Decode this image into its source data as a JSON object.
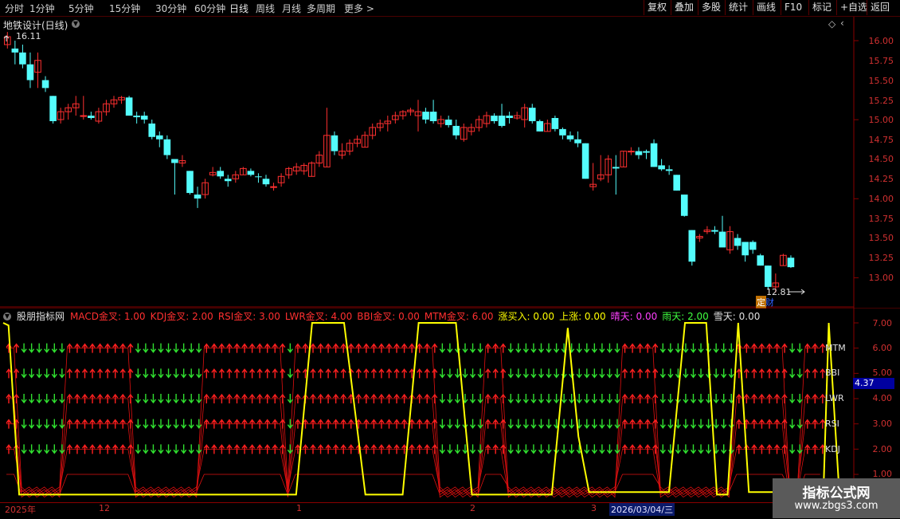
{
  "toolbar": {
    "periods": [
      "分时",
      "1分钟",
      "5分钟",
      "15分钟",
      "30分钟",
      "60分钟",
      "日线",
      "周线",
      "月线",
      "多周期",
      "更多 >"
    ],
    "active_period": "日线",
    "buttons": [
      "复权",
      "叠加",
      "多股",
      "统计",
      "画线",
      "F10",
      "标记",
      "+自选",
      "返回"
    ]
  },
  "chart": {
    "title": "地铁设计(日线)",
    "high_label": "16.11",
    "low_label": "12.81",
    "ding_label": "定",
    "cai_label": "财",
    "price_ticks": [
      "16.00",
      "15.75",
      "15.50",
      "15.25",
      "15.00",
      "14.75",
      "14.50",
      "14.25",
      "14.00",
      "13.75",
      "13.50",
      "13.25",
      "13.00"
    ]
  },
  "indicator": {
    "name": "股朋指标网",
    "values": [
      {
        "label": "MACD金叉: 1.00",
        "color": "#ff3030"
      },
      {
        "label": "KDJ金叉: 2.00",
        "color": "#ff3030"
      },
      {
        "label": "RSI金叉: 3.00",
        "color": "#ff3030"
      },
      {
        "label": "LWR金叉: 4.00",
        "color": "#ff3030"
      },
      {
        "label": "BBI金叉: 0.00",
        "color": "#ff3030"
      },
      {
        "label": "MTM金叉: 6.00",
        "color": "#ff3030"
      },
      {
        "label": "涨买入: 0.00",
        "color": "#ffff00"
      },
      {
        "label": "上涨: 0.00",
        "color": "#ffff00"
      },
      {
        "label": "晴天: 0.00",
        "color": "#ff40ff"
      },
      {
        "label": "雨天: 2.00",
        "color": "#40ff40"
      },
      {
        "label": "雪天: 0.00",
        "color": "#e0e0e0"
      }
    ],
    "ticks": [
      "7.00",
      "6.00",
      "5.00",
      "4.00",
      "3.00",
      "2.00",
      "1.00"
    ],
    "current_value": "4.37",
    "line_labels": [
      "MTM",
      "BBI",
      "LWR",
      "RSI",
      "KDJ"
    ]
  },
  "dates": {
    "labels": [
      "2025年",
      "12",
      "1",
      "2",
      "3"
    ],
    "highlight": "2026/03/04/三"
  },
  "watermark": {
    "title": "指标公式网",
    "url": "www.zbgs3.com"
  },
  "candles": [
    [
      15.95,
      16.11,
      15.9,
      16.05
    ],
    [
      15.9,
      16.0,
      15.7,
      15.85
    ],
    [
      15.85,
      15.95,
      15.65,
      15.7
    ],
    [
      15.7,
      15.85,
      15.4,
      15.5
    ],
    [
      15.6,
      15.85,
      15.4,
      15.75
    ],
    [
      15.5,
      15.55,
      15.35,
      15.4
    ],
    [
      15.3,
      15.3,
      14.95,
      14.98
    ],
    [
      15.0,
      15.15,
      14.95,
      15.1
    ],
    [
      15.1,
      15.2,
      15.0,
      15.15
    ],
    [
      15.15,
      15.3,
      15.05,
      15.2
    ],
    [
      15.05,
      15.3,
      15.0,
      15.05
    ],
    [
      15.05,
      15.1,
      15.0,
      15.02
    ],
    [
      14.98,
      15.15,
      14.95,
      15.1
    ],
    [
      15.1,
      15.25,
      15.05,
      15.2
    ],
    [
      15.2,
      15.3,
      15.15,
      15.25
    ],
    [
      15.25,
      15.3,
      15.2,
      15.28
    ],
    [
      15.28,
      15.3,
      15.05,
      15.05
    ],
    [
      15.05,
      15.1,
      14.95,
      15.03
    ],
    [
      15.05,
      15.1,
      14.95,
      15.0
    ],
    [
      14.95,
      15.0,
      14.75,
      14.78
    ],
    [
      14.8,
      14.85,
      14.65,
      14.75
    ],
    [
      14.75,
      14.8,
      14.5,
      14.55
    ],
    [
      14.5,
      14.5,
      14.05,
      14.45
    ],
    [
      14.45,
      14.55,
      14.4,
      14.48
    ],
    [
      14.35,
      14.35,
      14.05,
      14.07
    ],
    [
      14.05,
      14.15,
      13.88,
      14.0
    ],
    [
      14.05,
      14.25,
      14.0,
      14.2
    ],
    [
      14.3,
      14.4,
      14.28,
      14.33
    ],
    [
      14.35,
      14.4,
      14.25,
      14.28
    ],
    [
      14.25,
      14.3,
      14.15,
      14.22
    ],
    [
      14.25,
      14.35,
      14.2,
      14.3
    ],
    [
      14.3,
      14.4,
      14.3,
      14.38
    ],
    [
      14.35,
      14.38,
      14.28,
      14.3
    ],
    [
      14.28,
      14.32,
      14.2,
      14.27
    ],
    [
      14.25,
      14.3,
      14.15,
      14.18
    ],
    [
      14.15,
      14.2,
      14.1,
      14.15
    ],
    [
      14.2,
      14.32,
      14.15,
      14.28
    ],
    [
      14.3,
      14.4,
      14.25,
      14.38
    ],
    [
      14.35,
      14.45,
      14.3,
      14.4
    ],
    [
      14.35,
      14.45,
      14.3,
      14.42
    ],
    [
      14.28,
      14.47,
      14.28,
      14.45
    ],
    [
      14.45,
      14.6,
      14.4,
      14.55
    ],
    [
      14.4,
      15.15,
      14.4,
      14.8
    ],
    [
      14.8,
      14.85,
      14.55,
      14.6
    ],
    [
      14.55,
      14.7,
      14.5,
      14.6
    ],
    [
      14.6,
      14.75,
      14.55,
      14.7
    ],
    [
      14.7,
      14.8,
      14.65,
      14.75
    ],
    [
      14.65,
      14.85,
      14.65,
      14.8
    ],
    [
      14.8,
      14.95,
      14.75,
      14.9
    ],
    [
      14.9,
      15.0,
      14.85,
      14.95
    ],
    [
      14.95,
      15.05,
      14.85,
      14.98
    ],
    [
      15.0,
      15.1,
      14.95,
      15.05
    ],
    [
      15.05,
      15.12,
      15.0,
      15.1
    ],
    [
      15.1,
      15.15,
      15.05,
      15.12
    ],
    [
      15.05,
      15.25,
      14.85,
      15.1
    ],
    [
      15.1,
      15.15,
      14.95,
      15.0
    ],
    [
      15.1,
      15.25,
      14.95,
      14.98
    ],
    [
      14.95,
      15.05,
      14.9,
      15.0
    ],
    [
      15.0,
      15.05,
      14.9,
      14.93
    ],
    [
      14.92,
      15.0,
      14.75,
      14.8
    ],
    [
      14.75,
      14.95,
      14.72,
      14.9
    ],
    [
      14.85,
      14.95,
      14.8,
      14.9
    ],
    [
      14.9,
      15.05,
      14.85,
      15.0
    ],
    [
      14.95,
      15.1,
      14.9,
      15.05
    ],
    [
      15.05,
      15.08,
      14.95,
      14.98
    ],
    [
      15.05,
      15.2,
      14.9,
      14.92
    ],
    [
      15.05,
      15.1,
      14.95,
      15.02
    ],
    [
      15.02,
      15.1,
      15.0,
      15.05
    ],
    [
      15.0,
      15.2,
      14.9,
      15.15
    ],
    [
      15.15,
      15.2,
      14.95,
      14.98
    ],
    [
      14.98,
      15.0,
      14.85,
      14.85
    ],
    [
      14.85,
      15.0,
      14.85,
      14.95
    ],
    [
      15.02,
      15.05,
      14.85,
      14.88
    ],
    [
      14.88,
      14.9,
      14.75,
      14.8
    ],
    [
      14.8,
      14.85,
      14.72,
      14.75
    ],
    [
      14.75,
      14.85,
      14.65,
      14.7
    ],
    [
      14.7,
      14.7,
      14.25,
      14.25
    ],
    [
      14.15,
      14.45,
      14.1,
      14.18
    ],
    [
      14.25,
      14.55,
      14.22,
      14.3
    ],
    [
      14.3,
      14.55,
      14.2,
      14.5
    ],
    [
      14.4,
      14.55,
      14.05,
      14.38
    ],
    [
      14.4,
      14.6,
      14.4,
      14.6
    ],
    [
      14.6,
      14.65,
      14.55,
      14.6
    ],
    [
      14.6,
      14.65,
      14.5,
      14.55
    ],
    [
      14.6,
      14.62,
      14.5,
      14.58
    ],
    [
      14.7,
      14.75,
      14.4,
      14.4
    ],
    [
      14.42,
      14.5,
      14.35,
      14.37
    ],
    [
      14.37,
      14.42,
      14.3,
      14.35
    ],
    [
      14.3,
      14.3,
      14.1,
      14.1
    ],
    [
      14.05,
      14.05,
      13.77,
      13.78
    ],
    [
      13.6,
      13.6,
      13.15,
      13.2
    ],
    [
      13.5,
      13.55,
      13.45,
      13.52
    ],
    [
      13.58,
      13.65,
      13.55,
      13.6
    ],
    [
      13.6,
      13.65,
      13.55,
      13.58
    ],
    [
      13.58,
      13.78,
      13.4,
      13.38
    ],
    [
      13.35,
      13.65,
      13.3,
      13.58
    ],
    [
      13.5,
      13.55,
      13.35,
      13.4
    ],
    [
      13.45,
      13.45,
      13.2,
      13.28
    ],
    [
      13.45,
      13.47,
      13.3,
      13.35
    ],
    [
      13.28,
      13.3,
      13.15,
      13.15
    ],
    [
      13.15,
      13.15,
      12.85,
      12.88
    ],
    [
      12.88,
      13.05,
      12.81,
      12.93
    ],
    [
      13.15,
      13.3,
      13.15,
      13.28
    ],
    [
      13.25,
      13.28,
      13.12,
      13.13
    ]
  ],
  "ind_red": [
    1,
    1,
    0,
    0,
    0,
    0,
    0,
    0,
    1,
    1,
    1,
    1,
    1,
    1,
    1,
    1,
    1,
    0,
    0,
    0,
    0,
    0,
    0,
    0,
    0,
    0,
    1,
    1,
    1,
    1,
    1,
    1,
    1,
    1,
    1,
    1,
    1,
    0,
    1,
    1,
    1,
    1,
    1,
    1,
    1,
    1,
    1,
    1,
    1,
    1,
    1,
    1,
    1,
    1,
    1,
    1,
    1,
    0,
    0,
    0,
    0,
    0,
    0,
    1,
    1,
    1,
    0,
    0,
    0,
    0,
    0,
    0,
    0,
    0,
    0,
    0,
    0,
    0,
    0,
    0,
    0,
    1,
    1,
    1,
    1,
    1,
    0,
    0,
    0,
    0,
    0,
    0,
    0,
    0,
    0,
    0,
    1,
    1,
    1,
    1,
    1,
    1,
    1,
    0,
    0,
    1,
    1,
    1
  ],
  "yellow_line": [
    [
      0,
      7.0
    ],
    [
      1,
      6.9
    ],
    [
      3,
      0.2
    ],
    [
      55,
      0.2
    ],
    [
      58,
      7.0
    ],
    [
      64,
      7.0
    ],
    [
      68,
      0.2
    ],
    [
      75,
      0.2
    ],
    [
      78,
      7.0
    ],
    [
      85,
      7.0
    ],
    [
      88,
      0.2
    ],
    [
      103,
      0.2
    ],
    [
      106,
      6.8
    ],
    [
      108,
      2.5
    ],
    [
      110,
      0.3
    ],
    [
      125,
      0.3
    ],
    [
      128,
      7.0
    ],
    [
      132,
      7.0
    ],
    [
      134,
      0.2
    ],
    [
      136,
      0.2
    ],
    [
      138,
      7.0
    ],
    [
      140,
      0.3
    ],
    [
      154,
      0.3
    ],
    [
      155,
      7.0
    ],
    [
      157,
      0.2
    ],
    [
      160,
      0.2
    ]
  ]
}
